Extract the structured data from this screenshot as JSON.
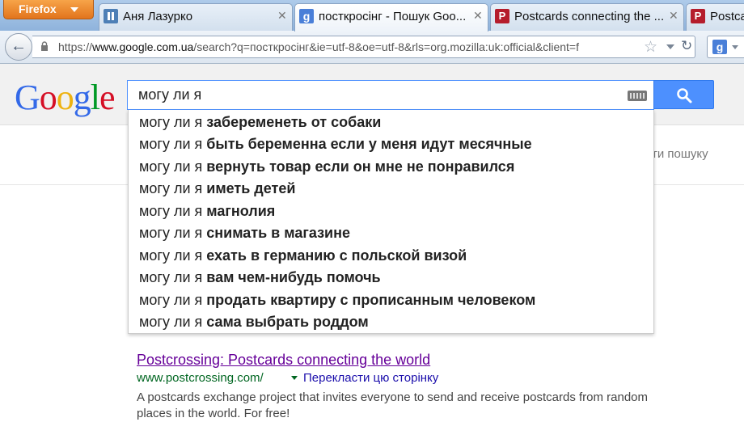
{
  "browser": {
    "menu_label": "Firefox",
    "tabs": [
      {
        "label": "Аня Лазурко",
        "icon": "pause-icon"
      },
      {
        "label": "посткросінг - Пошук Goo...",
        "icon": "google-icon"
      },
      {
        "label": "Postcards connecting the ...",
        "icon": "postcrossing-icon"
      },
      {
        "label": "Postcar",
        "icon": "postcrossing-icon"
      }
    ],
    "close_glyph": "✕",
    "url_prefix": "https://",
    "url_host": "www.google.com.ua",
    "url_path": "/search?q=посткросінг&ie=utf-8&oe=utf-8&rls=org.mozilla:uk:official&client=f",
    "search_engine_glyph": "g"
  },
  "google": {
    "logo_letters": [
      {
        "ch": "G",
        "color": "#3369e8"
      },
      {
        "ch": "o",
        "color": "#d50f25"
      },
      {
        "ch": "o",
        "color": "#eeb211"
      },
      {
        "ch": "g",
        "color": "#3369e8"
      },
      {
        "ch": "l",
        "color": "#009925"
      },
      {
        "ch": "e",
        "color": "#d50f25"
      }
    ],
    "query": "могу ли я",
    "partial_tool_text": "ти пошуку",
    "suggestions": [
      {
        "prefix": "могу ли я ",
        "completion": "забеременеть от собаки"
      },
      {
        "prefix": "могу ли я ",
        "completion": "быть беременна если у меня идут месячные"
      },
      {
        "prefix": "могу ли я ",
        "completion": "вернуть товар если он мне не понравился"
      },
      {
        "prefix": "могу ли я ",
        "completion": "иметь детей"
      },
      {
        "prefix": "могу ли я ",
        "completion": "магнолия"
      },
      {
        "prefix": "могу ли я ",
        "completion": "снимать в магазине"
      },
      {
        "prefix": "могу ли я ",
        "completion": "ехать в германию с польской визой"
      },
      {
        "prefix": "могу ли я ",
        "completion": "вам чем-нибудь помочь"
      },
      {
        "prefix": "могу ли я ",
        "completion": "продать квартиру с прописанным человеком"
      },
      {
        "prefix": "могу ли я ",
        "completion": "сама выбрать роддом"
      }
    ],
    "result": {
      "title": "Postcrossing: Postcards connecting the world",
      "url": "www.postcrossing.com/",
      "translate_label": "Перекласти цю сторінку",
      "snippet": "A postcards exchange project that invites everyone to send and receive postcards from random places in the world. For free!"
    }
  },
  "colors": {
    "accent": "#4d90fe",
    "visited_link": "#660099",
    "url_green": "#006621",
    "firefox_orange": "#e2741c"
  }
}
